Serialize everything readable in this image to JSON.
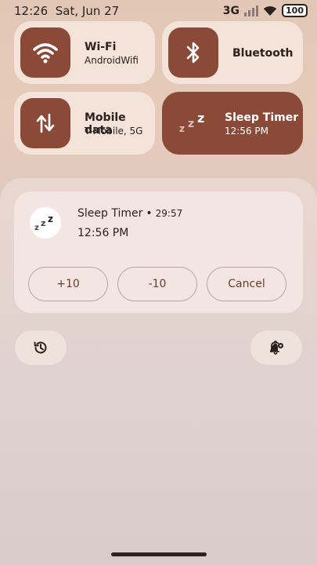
{
  "status_bar": {
    "time": "12:26",
    "date": "Sat, Jun 27",
    "network": "3G",
    "battery": "100"
  },
  "tiles": [
    {
      "title": "Wi-Fi",
      "subtitle": "AndroidWifi",
      "icon": "wifi-icon",
      "active": false
    },
    {
      "title": "Bluetooth",
      "subtitle": "",
      "icon": "bluetooth-icon",
      "active": false
    },
    {
      "title": "Mobile data",
      "subtitle": "T-Mobile, 5G",
      "icon": "mobile-data-icon",
      "active": false
    },
    {
      "title": "Sleep Timer",
      "subtitle": "12:56 PM",
      "icon": "sleep-zzz-icon",
      "active": true
    }
  ],
  "notification": {
    "app": "Sleep Timer",
    "dot": "•",
    "countdown": "29:57",
    "time": "12:56 PM",
    "actions": {
      "plus": "+10",
      "minus": "-10",
      "cancel": "Cancel"
    }
  },
  "bottom_buttons": {
    "history_icon": "history-icon",
    "settings_icon": "notification-settings-icon"
  },
  "colors": {
    "accent": "#8a4a37",
    "tile_bg": "#f3e3d9",
    "card_bg": "#f3e6e2",
    "text": "#2b211e"
  }
}
